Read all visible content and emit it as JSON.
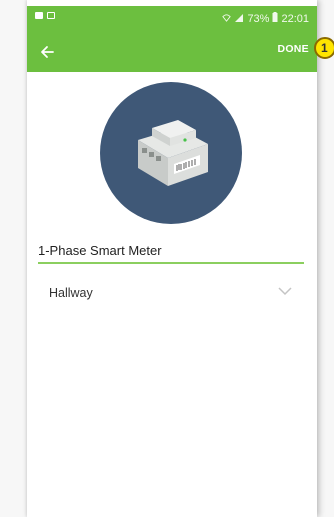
{
  "status_bar": {
    "battery": "73%",
    "time": "22:01"
  },
  "app_bar": {
    "back_icon": "arrow-left-icon",
    "done_label": "DONE",
    "color": "#6cbf3f"
  },
  "annotation": {
    "number": "1"
  },
  "device": {
    "icon": "smart-meter-image",
    "circle_color": "#3f5877",
    "name_value": "1-Phase Smart Meter"
  },
  "location": {
    "selected": "Hallway",
    "dropdown_icon": "chevron-down-icon"
  }
}
